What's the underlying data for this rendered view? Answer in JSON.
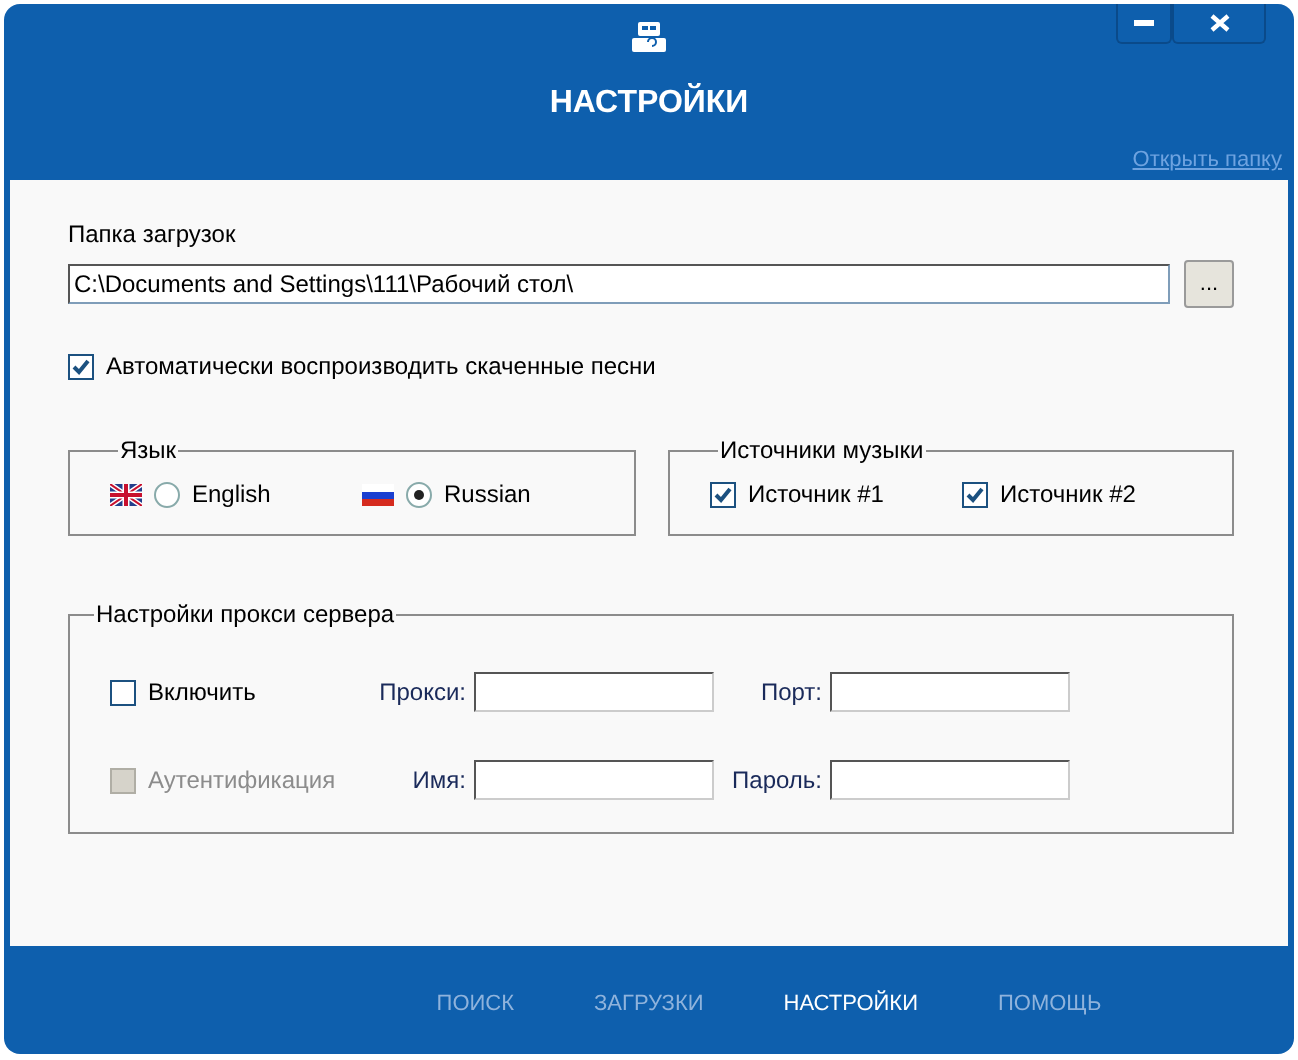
{
  "window": {
    "title": "НАСТРОЙКИ"
  },
  "open_folder_link": "Открыть папку",
  "download_folder": {
    "label": "Папка загрузок",
    "value": "C:\\Documents and Settings\\111\\Рабочий стол\\",
    "browse_button": "..."
  },
  "auto_play": {
    "label": "Автоматически воспроизводить скаченные песни",
    "checked": true
  },
  "language": {
    "title": "Язык",
    "options": [
      {
        "label": "English",
        "selected": false,
        "kind": "uk"
      },
      {
        "label": "Russian",
        "selected": true,
        "kind": "ru"
      }
    ]
  },
  "sources": {
    "title": "Источники музыки",
    "items": [
      {
        "label": "Источник #1",
        "checked": true
      },
      {
        "label": "Источник #2",
        "checked": true
      }
    ]
  },
  "proxy": {
    "title": "Настройки прокси сервера",
    "enable": {
      "label": "Включить",
      "checked": false,
      "disabled": false
    },
    "auth": {
      "label": "Аутентификация",
      "checked": false,
      "disabled": true
    },
    "fields": [
      {
        "label": "Прокси:"
      },
      {
        "label": "Порт:"
      },
      {
        "label": "Имя:"
      },
      {
        "label": "Пароль:"
      }
    ]
  },
  "nav": [
    {
      "label": "ПОИСК",
      "selected": false
    },
    {
      "label": "ЗАГРУЗКИ",
      "selected": false
    },
    {
      "label": "НАСТРОЙКИ",
      "selected": true
    },
    {
      "label": "ПОМОЩЬ",
      "selected": false
    }
  ]
}
